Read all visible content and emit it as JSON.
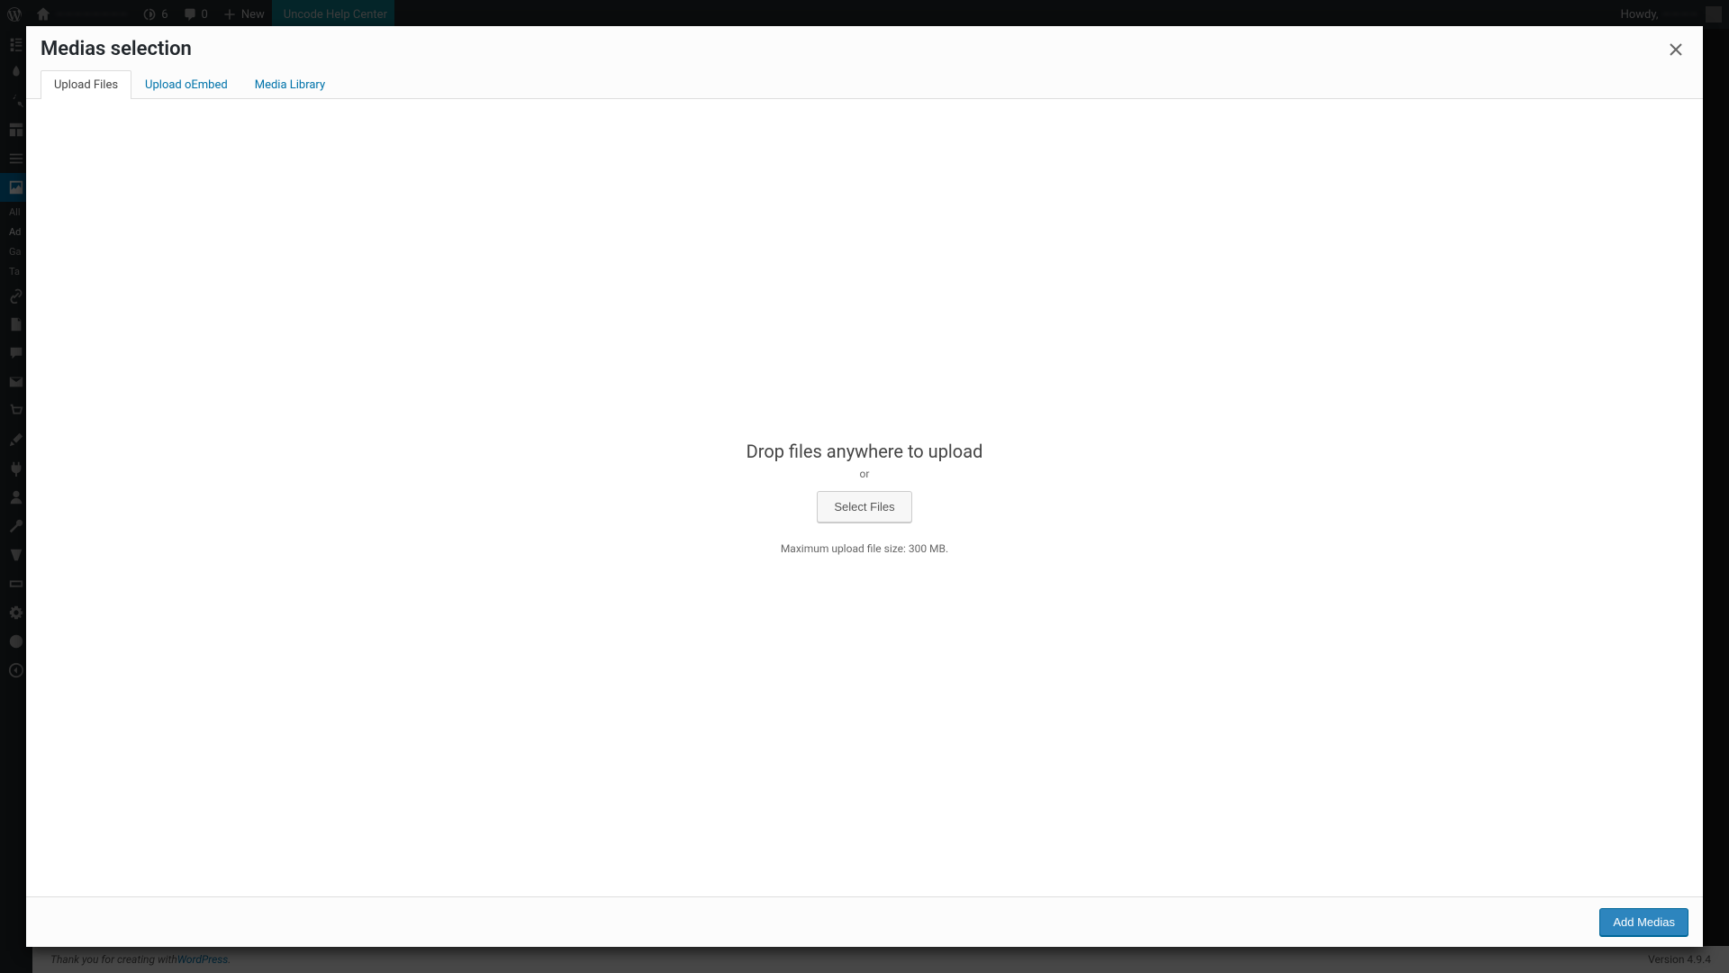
{
  "adminbar": {
    "site_label": "————————",
    "updates_count": "6",
    "comments_count": "0",
    "new_label": "New",
    "help_label": "Uncode Help Center",
    "howdy_label": "Howdy,",
    "user_name": "————"
  },
  "sidebar": {
    "submenu": [
      "All",
      "Ad",
      "Ga",
      "Ta"
    ]
  },
  "modal": {
    "title": "Medias selection",
    "tabs": [
      {
        "label": "Upload Files",
        "active": true
      },
      {
        "label": "Upload oEmbed",
        "active": false
      },
      {
        "label": "Media Library",
        "active": false
      }
    ],
    "uploader": {
      "title": "Drop files anywhere to upload",
      "or": "or",
      "select_button": "Select Files",
      "hint": "Maximum upload file size: 300 MB."
    },
    "add_button": "Add Medias"
  },
  "footer": {
    "prefix": "Thank you for creating with ",
    "link": "WordPress",
    "version": "Version 4.9.4"
  }
}
